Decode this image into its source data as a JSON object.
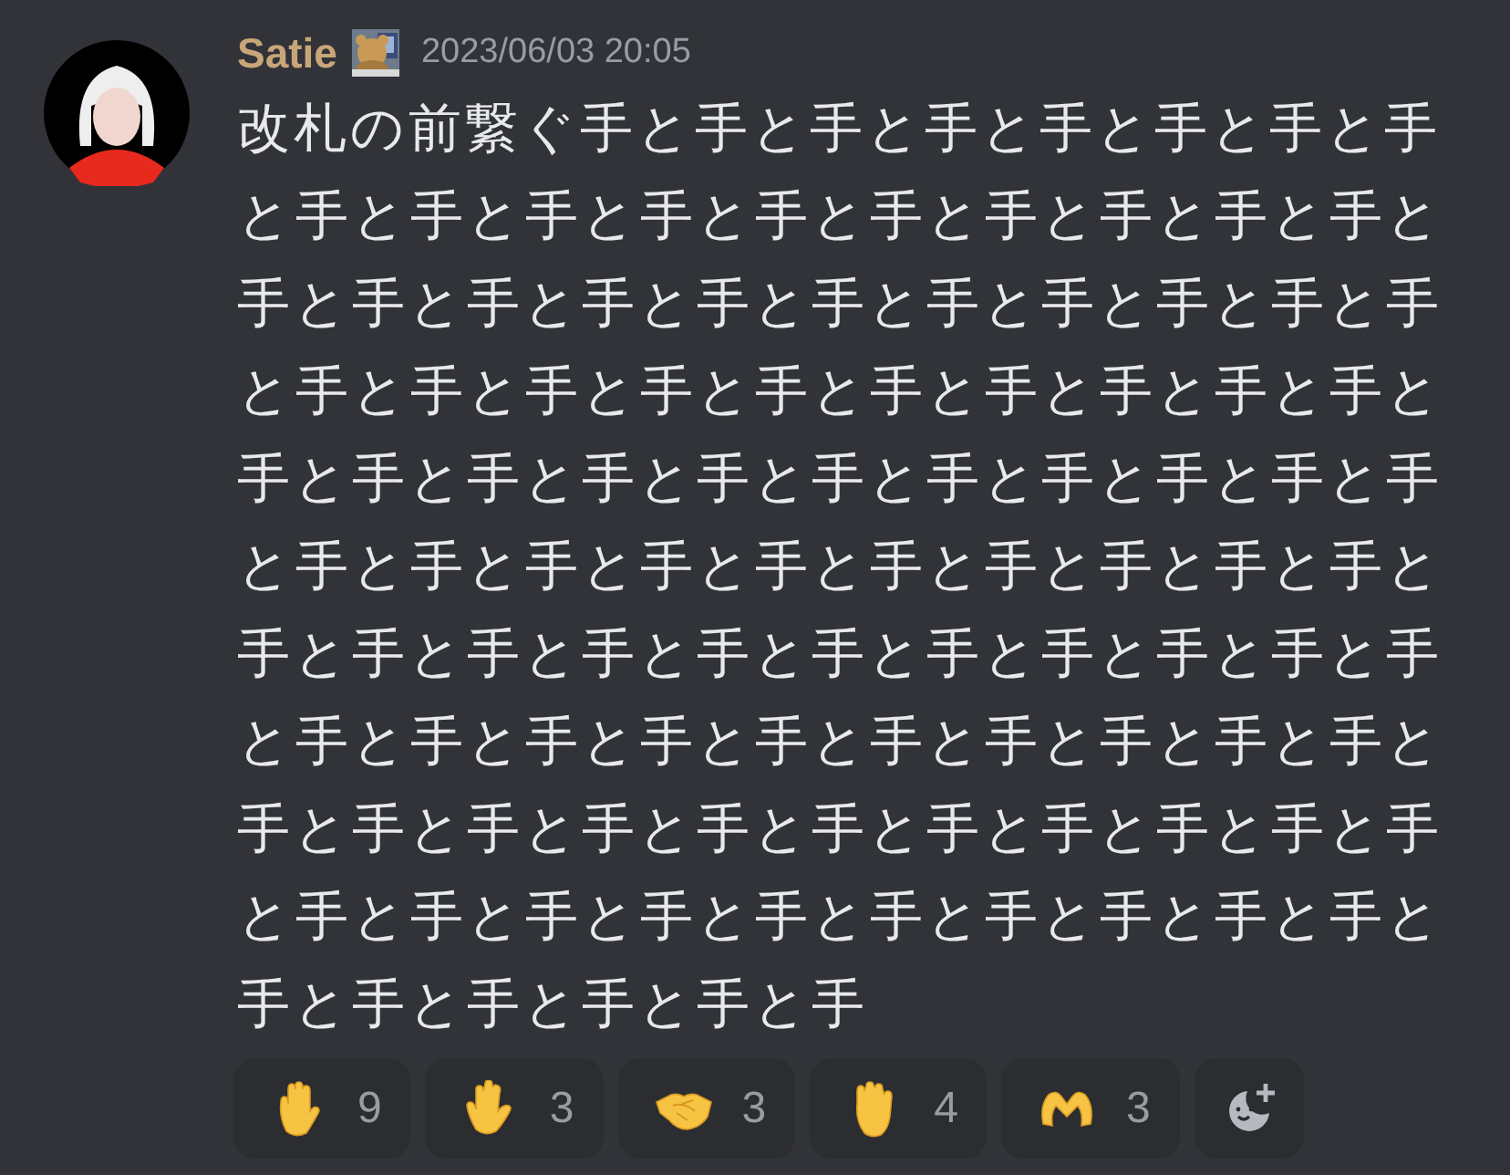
{
  "message": {
    "author": "Satie",
    "timestamp": "2023/06/03 20:05",
    "text": "改札の前繋ぐ手と手と手と手と手と手と手と手と手と手と手と手と手と手と手と手と手と手と手と手と手と手と手と手と手と手と手と手と手と手と手と手と手と手と手と手と手と手と手と手と手と手と手と手と手と手と手と手と手と手と手と手と手と手と手と手と手と手と手と手と手と手と手と手と手と手と手と手と手と手と手と手と手と手と手と手と手と手と手と手と手と手と手と手と手と手と手と手と手と手と手と手と手と手と手と手と手と手と手と手と手と手と手と手と手と手と手と手"
  },
  "reactions": [
    {
      "kind": "raised-hand",
      "count": "9"
    },
    {
      "kind": "splayed-hand",
      "count": "3"
    },
    {
      "kind": "handshake",
      "count": "3"
    },
    {
      "kind": "back-hand",
      "count": "4"
    },
    {
      "kind": "heart-hands",
      "count": "3"
    }
  ]
}
